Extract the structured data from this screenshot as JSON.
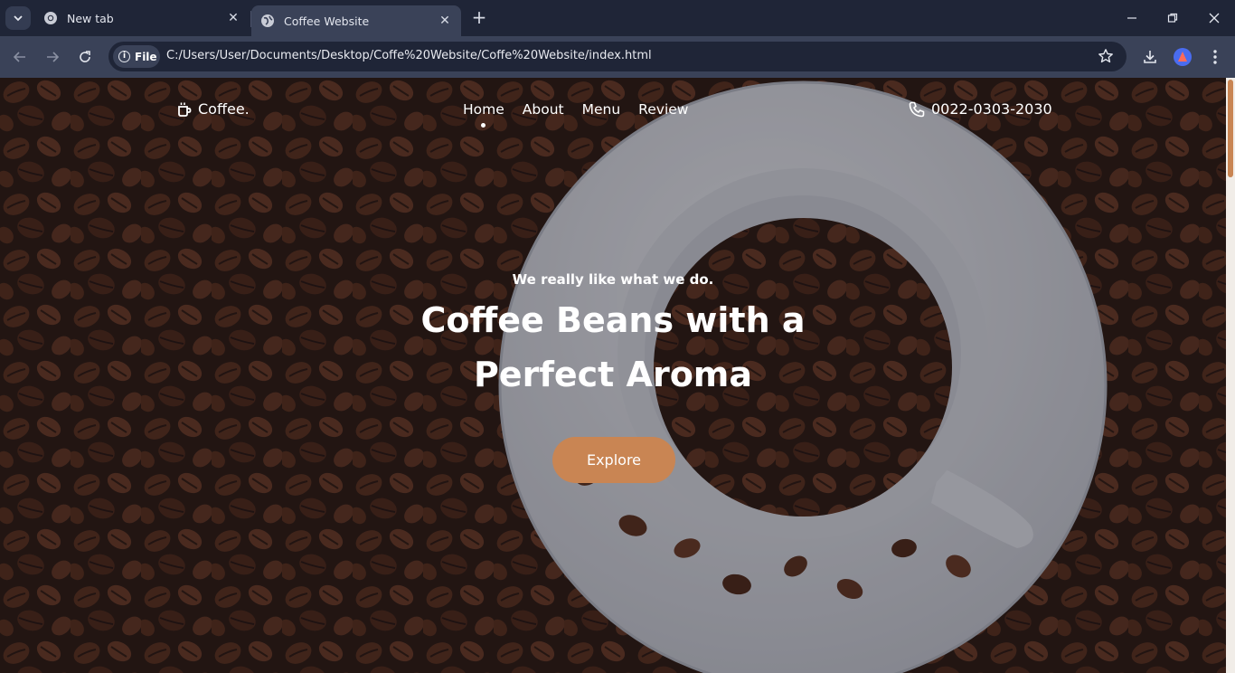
{
  "browser": {
    "tabs": [
      {
        "title": "New tab",
        "active": false
      },
      {
        "title": "Coffee Website",
        "active": true
      }
    ],
    "address": {
      "chip_label": "File",
      "url": "C:/Users/User/Documents/Desktop/Coffe%20Website/Coffe%20Website/index.html"
    }
  },
  "site": {
    "logo_text": "Coffee.",
    "nav": [
      {
        "label": "Home",
        "active": true
      },
      {
        "label": "About",
        "active": false
      },
      {
        "label": "Menu",
        "active": false
      },
      {
        "label": "Review",
        "active": false
      }
    ],
    "phone": "0022-0303-2030",
    "hero": {
      "tagline": "We really like what we do.",
      "title_line1": "Coffee Beans with a",
      "title_line2": "Perfect Aroma",
      "cta": "Explore"
    }
  },
  "colors": {
    "accent": "#c98553",
    "tabstrip": "#1f2537",
    "toolbar": "#3a4258"
  },
  "icons": [
    "chevron-down-icon",
    "chrome-icon",
    "globe-icon",
    "close-icon",
    "plus-icon",
    "minimize-icon",
    "restore-icon",
    "back-icon",
    "forward-icon",
    "reload-icon",
    "info-icon",
    "star-icon",
    "download-icon",
    "menu-dots-icon",
    "mug-icon",
    "phone-icon"
  ]
}
